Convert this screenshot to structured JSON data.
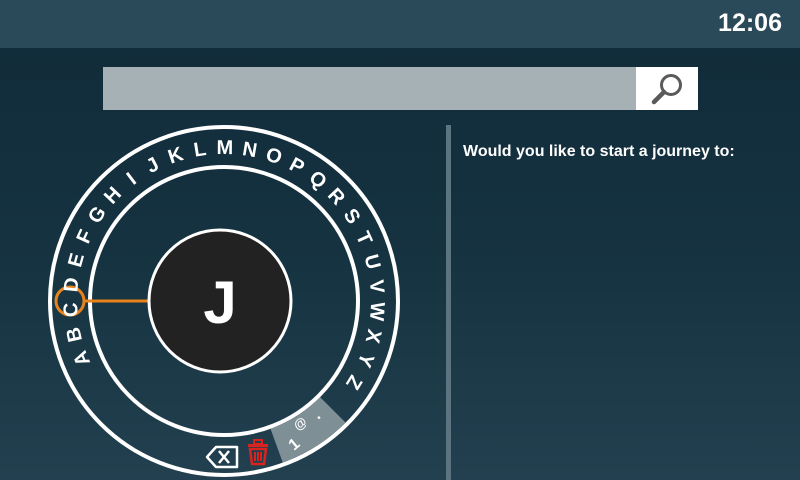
{
  "header": {
    "time": "12:06"
  },
  "search": {
    "value": "",
    "placeholder": "",
    "icon": "search-icon"
  },
  "prompt": {
    "text": "Would you like to start a journey to:"
  },
  "dial": {
    "letters": [
      "A",
      "B",
      "C",
      "D",
      "E",
      "F",
      "G",
      "H",
      "I",
      "J",
      "K",
      "L",
      "M",
      "N",
      "O",
      "P",
      "Q",
      "R",
      "S",
      "T",
      "U",
      "V",
      "W",
      "X",
      "Y",
      "Z"
    ],
    "highlighted": "G",
    "current": "J",
    "mode_key": {
      "chars": [
        "1",
        "@",
        "."
      ]
    },
    "backspace_icon": "backspace-icon",
    "delete_icon": "trash-icon",
    "colors": {
      "ring": "#ffffff",
      "center_fill": "#222222",
      "highlight": "#e8831c",
      "delete": "#d8231f",
      "mode_key_bg": "#7f8f96"
    }
  }
}
